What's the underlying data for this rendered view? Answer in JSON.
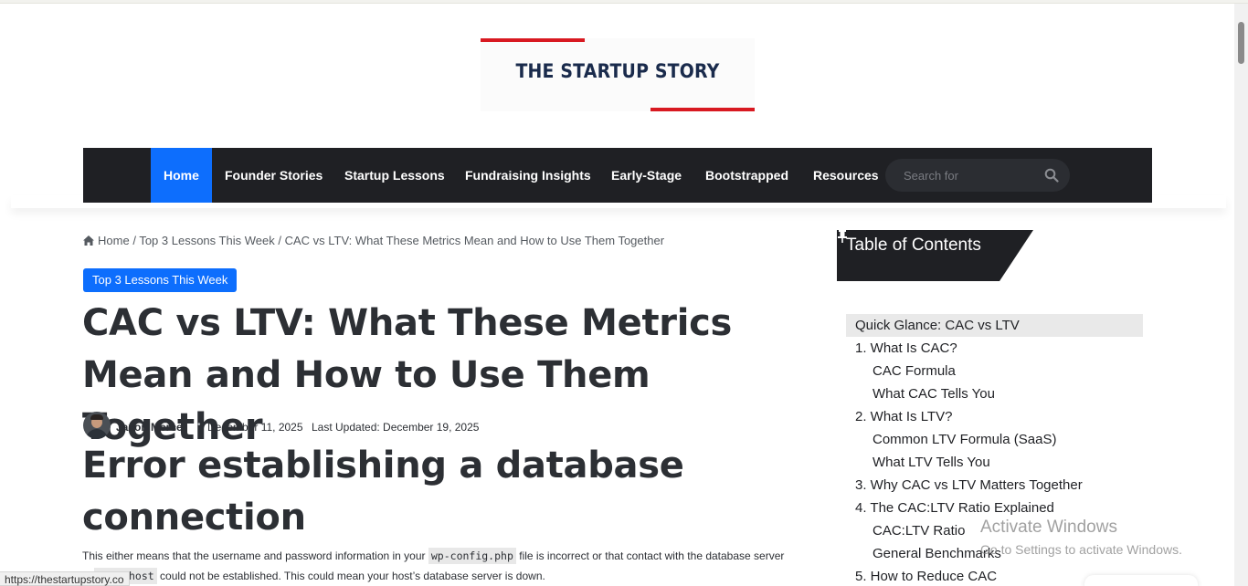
{
  "site": {
    "logo_text": "THE STARTUP STORY"
  },
  "nav": {
    "items": [
      {
        "label": "Home",
        "active": true
      },
      {
        "label": "Founder Stories"
      },
      {
        "label": "Startup Lessons"
      },
      {
        "label": "Fundraising Insights"
      },
      {
        "label": "Early-Stage"
      },
      {
        "label": "Bootstrapped"
      },
      {
        "label": "Resources"
      }
    ],
    "search_placeholder": "Search for",
    "search_icon": "search-icon"
  },
  "breadcrumb": {
    "home": "Home",
    "sep1": "/",
    "category": "Top 3 Lessons This Week",
    "sep2": "/",
    "current": "CAC vs LTV: What These Metrics Mean and How to Use Them Together"
  },
  "post": {
    "category_badge": "Top 3 Lessons This Week",
    "title": "CAC vs LTV: What These Metrics Mean and How to Use Them Together",
    "author": "Jaxon Mercer",
    "date": "December 11, 2025",
    "updated": "Last Updated: December 19, 2025"
  },
  "error": {
    "title": "Error establishing a database connection",
    "text_1": "This either means that the username and password information in your",
    "code_1": "wp-config.php",
    "text_2": "file is incorrect or that contact with the database server at",
    "code_2": "localhost",
    "text_3": "could not be established. This could mean your host’s database server is down."
  },
  "toc": {
    "title": "Table of Contents",
    "pin_icon": "pin-icon",
    "items": [
      {
        "label": "Quick Glance: CAC vs LTV",
        "level": 1,
        "active": true
      },
      {
        "label": "1. What Is CAC?",
        "level": 1
      },
      {
        "label": "CAC Formula",
        "level": 2
      },
      {
        "label": "What CAC Tells You",
        "level": 2
      },
      {
        "label": "2. What Is LTV?",
        "level": 1
      },
      {
        "label": "Common LTV Formula (SaaS)",
        "level": 2
      },
      {
        "label": "What LTV Tells You",
        "level": 2
      },
      {
        "label": "3. Why CAC vs LTV Matters Together",
        "level": 1
      },
      {
        "label": "4. The CAC:LTV Ratio Explained",
        "level": 1
      },
      {
        "label": "CAC:LTV Ratio",
        "level": 2
      },
      {
        "label": "General Benchmarks",
        "level": 2
      },
      {
        "label": "5. How to Reduce CAC",
        "level": 1
      }
    ]
  },
  "status_bar": {
    "url": "https://thestartupstory.co"
  },
  "watermark": {
    "title": "Activate Windows",
    "subtitle": "Go to Settings to activate Windows."
  },
  "colors": {
    "accent": "#0d6efd",
    "nav_bg": "#1f2024",
    "logo_red": "#d81921",
    "logo_navy": "#1a2b4c"
  }
}
